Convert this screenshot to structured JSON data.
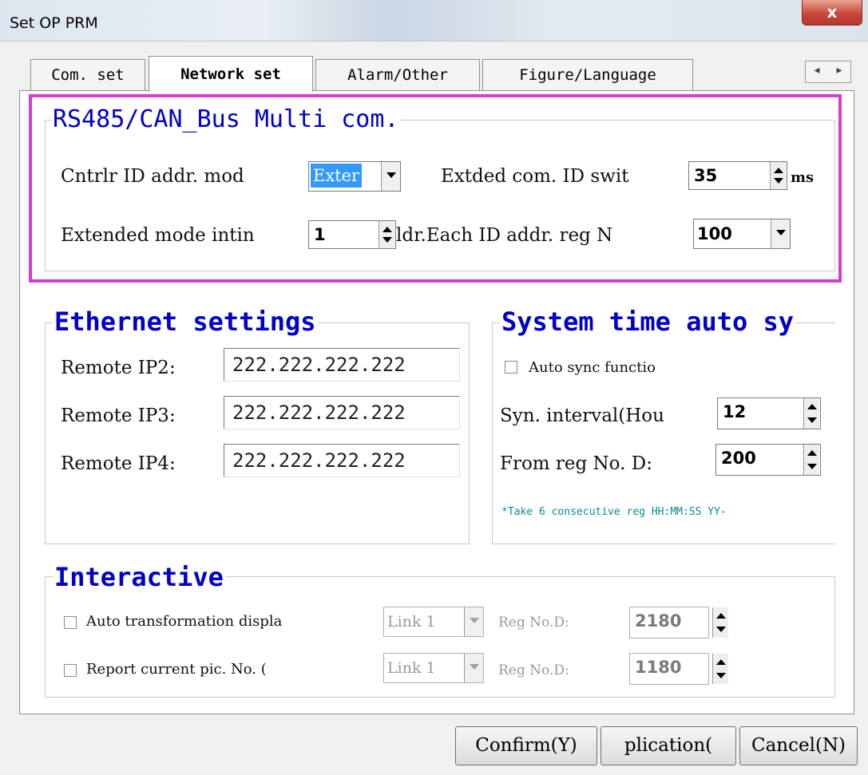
{
  "window": {
    "title": "Set OP PRM",
    "close_label": "x"
  },
  "tabs": [
    {
      "label": "Com. set",
      "active": false
    },
    {
      "label": "Network set",
      "active": true
    },
    {
      "label": "Alarm/Other",
      "active": false
    },
    {
      "label": "Figure/Language",
      "active": false
    }
  ],
  "tab_scroll": {
    "left": "◂",
    "right": "▸"
  },
  "rs485": {
    "title": "RS485/CAN_Bus Multi com.",
    "ctrl_id_label": "Cntrlr ID addr. mod",
    "ctrl_id_value": "Exter",
    "ext_com_label": "Extded com. ID swit",
    "ext_com_value": "35",
    "ext_com_unit": "ms",
    "ext_mode_label": "Extended mode intin",
    "ext_mode_value": "1",
    "each_id_label": "ldr.Each ID addr. reg N",
    "each_id_value": "100"
  },
  "ethernet": {
    "title": "Ethernet settings",
    "rows": [
      {
        "label": "Remote IP2:",
        "value": "222.222.222.222"
      },
      {
        "label": "Remote IP3:",
        "value": "222.222.222.222"
      },
      {
        "label": "Remote IP4:",
        "value": "222.222.222.222"
      }
    ]
  },
  "systime": {
    "title": "System time auto sy",
    "auto_sync_label": "Auto sync functio",
    "auto_sync_checked": false,
    "interval_label": "Syn. interval(Hou",
    "interval_value": "12",
    "from_reg_label": "From reg No. D:",
    "from_reg_value": "200",
    "note": "*Take 6 consecutive reg HH:MM:SS YY-"
  },
  "interactive": {
    "title": "Interactive",
    "rows": [
      {
        "label": "Auto transformation displa",
        "link": "Link 1",
        "reg_label": "Reg No.D:",
        "reg_value": "2180",
        "checked": false
      },
      {
        "label": "Report current pic. No.   (",
        "link": "Link 1",
        "reg_label": "Reg No.D:",
        "reg_value": "1180",
        "checked": false
      }
    ]
  },
  "buttons": {
    "confirm": "Confirm(Y)",
    "application": "plication(",
    "cancel": "Cancel(N)"
  },
  "colors": {
    "group_title": "#0000c8",
    "highlight": "#d43cd4",
    "note": "#0a8c8c",
    "selection": "#3399ff"
  }
}
